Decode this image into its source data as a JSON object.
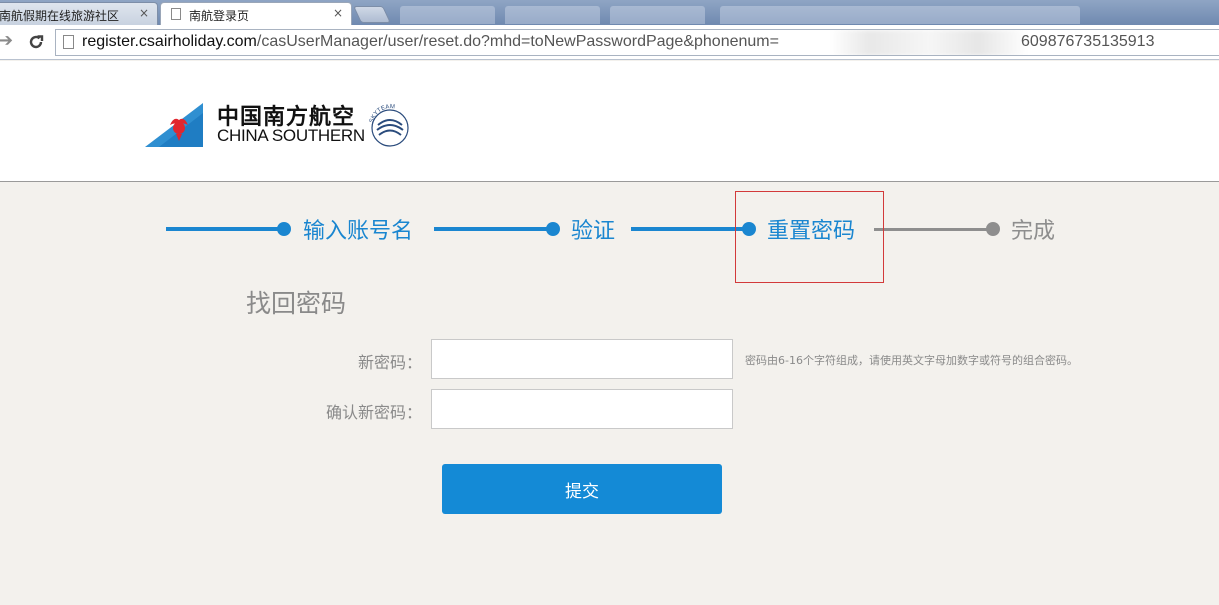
{
  "browser": {
    "tabs": [
      {
        "title": "南航假期在线旅游社区",
        "active": false
      },
      {
        "title": "南航登录页",
        "active": true
      }
    ],
    "close_glyph": "×",
    "url_host": "register.csairholiday.com",
    "url_path": "/casUserManager/user/reset.do?mhd=toNewPasswordPage&phonenum=",
    "url_tail": "609876735135913",
    "icons": {
      "forward": "forward-arrow-icon",
      "reload": "reload-icon",
      "page": "page-icon"
    }
  },
  "header": {
    "logo_cn": "中国南方航空",
    "logo_en": "CHINA SOUTHERN",
    "skyteam": "SKYTEAM"
  },
  "steps": [
    {
      "label": "输入账号名",
      "state": "done"
    },
    {
      "label": "验证",
      "state": "done"
    },
    {
      "label": "重置密码",
      "state": "current"
    },
    {
      "label": "完成",
      "state": "pending"
    }
  ],
  "form": {
    "title": "找回密码",
    "new_password_label": "新密码：",
    "confirm_password_label": "确认新密码：",
    "new_password_value": "",
    "confirm_password_value": "",
    "hint": "密码由6-16个字符组成，请使用英文字母加数字或符号的组合密码。",
    "submit_label": "提交"
  },
  "colors": {
    "accent": "#1a86d0",
    "pending": "#8e8e8e",
    "highlight": "#d23a3a",
    "page_bg": "#f3f1ed"
  }
}
